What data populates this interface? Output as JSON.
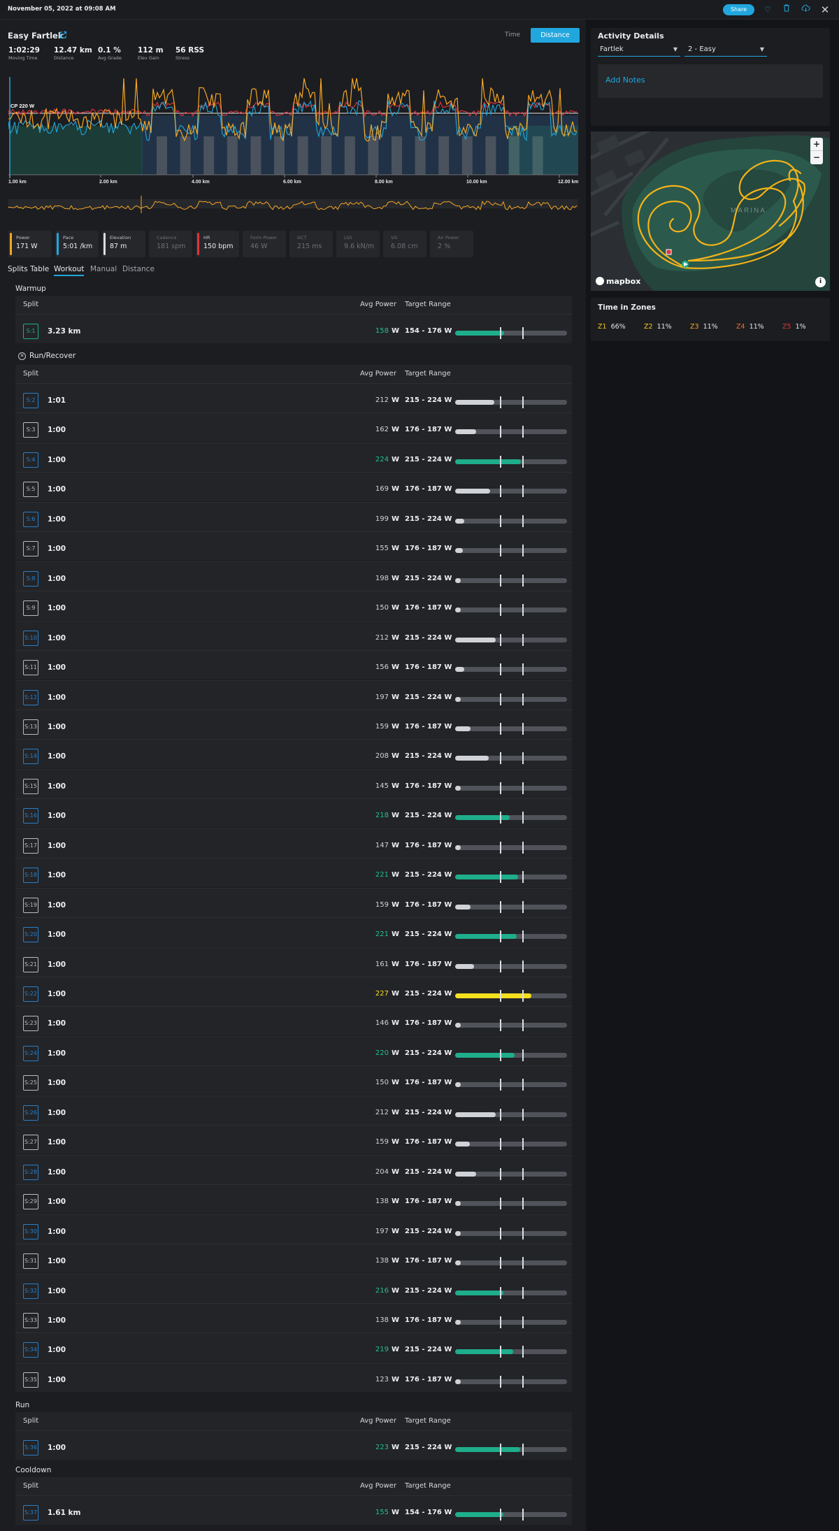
{
  "header": {
    "date": "November 05, 2022 at 09:08 AM",
    "share_label": "Share"
  },
  "activity": {
    "title": "Easy Fartlek",
    "toggle_time": "Time",
    "toggle_distance": "Distance"
  },
  "stats": [
    {
      "value": "1:02:29",
      "label": "Moving Time"
    },
    {
      "value": "12.47 km",
      "label": "Distance"
    },
    {
      "value": "0.1 %",
      "label": "Avg Grade"
    },
    {
      "value": "112 m",
      "label": "Elev Gain"
    },
    {
      "value": "56 RSS",
      "label": "Stress"
    }
  ],
  "chart": {
    "cp_label": "CP 220 W",
    "x_ticks": [
      "1.00 km",
      "2.00 km",
      "4.00 km",
      "6.00 km",
      "8.00 km",
      "10.00 km",
      "12.00 km"
    ]
  },
  "metrics": [
    {
      "name": "Power",
      "value": "171 W",
      "color": "#f5a623",
      "active": true
    },
    {
      "name": "Pace",
      "value": "5:01 /km",
      "color": "#21a7dd",
      "active": true
    },
    {
      "name": "Elevation",
      "value": "87 m",
      "color": "#d9dce1",
      "active": true
    },
    {
      "name": "Cadence",
      "value": "181 spm",
      "color": "",
      "active": false
    },
    {
      "name": "HR",
      "value": "150 bpm",
      "color": "#e0343e",
      "active": true
    },
    {
      "name": "Form Power",
      "value": "46 W",
      "color": "",
      "active": false
    },
    {
      "name": "GCT",
      "value": "215 ms",
      "color": "",
      "active": false
    },
    {
      "name": "LSS",
      "value": "9.6 kN/m",
      "color": "",
      "active": false
    },
    {
      "name": "VO",
      "value": "6.08 cm",
      "color": "",
      "active": false
    },
    {
      "name": "Air Power",
      "value": "2 %",
      "color": "",
      "active": false
    }
  ],
  "tabs": [
    "Splits Table",
    "Workout",
    "Manual",
    "Distance"
  ],
  "columns": {
    "split": "Split",
    "avg_power": "Avg Power",
    "target_range": "Target Range",
    "unit": "W"
  },
  "sections": {
    "warmup": "Warmup",
    "run_recover": "Run/Recover",
    "run": "Run",
    "cooldown": "Cooldown"
  },
  "warmup_rows": [
    {
      "id": "S:1",
      "split": "3.23 km",
      "power": "158",
      "range": "154 - 176 W",
      "fill": 0.44,
      "color": "green",
      "badge": "green"
    }
  ],
  "run_recover_rows": [
    {
      "id": "S:2",
      "split": "1:01",
      "power": "212",
      "range": "215 - 224 W",
      "fill": 0.35,
      "color": "gray",
      "badge": "blue"
    },
    {
      "id": "S:3",
      "split": "1:00",
      "power": "162",
      "range": "176 - 187 W",
      "fill": 0.19,
      "color": "gray",
      "badge": "gray"
    },
    {
      "id": "S:4",
      "split": "1:00",
      "power": "224",
      "range": "215 - 224 W",
      "fill": 0.59,
      "color": "green",
      "badge": "blue"
    },
    {
      "id": "S:5",
      "split": "1:00",
      "power": "169",
      "range": "176 - 187 W",
      "fill": 0.31,
      "color": "gray",
      "badge": "gray"
    },
    {
      "id": "S:6",
      "split": "1:00",
      "power": "199",
      "range": "215 - 224 W",
      "fill": 0.08,
      "color": "gray",
      "badge": "blue"
    },
    {
      "id": "S:7",
      "split": "1:00",
      "power": "155",
      "range": "176 - 187 W",
      "fill": 0.07,
      "color": "gray",
      "badge": "gray"
    },
    {
      "id": "S:8",
      "split": "1:00",
      "power": "198",
      "range": "215 - 224 W",
      "fill": 0.04,
      "color": "gray",
      "badge": "blue"
    },
    {
      "id": "S:9",
      "split": "1:00",
      "power": "150",
      "range": "176 - 187 W",
      "fill": 0.04,
      "color": "gray",
      "badge": "gray"
    },
    {
      "id": "S:10",
      "split": "1:00",
      "power": "212",
      "range": "215 - 224 W",
      "fill": 0.36,
      "color": "gray",
      "badge": "blue"
    },
    {
      "id": "S:11",
      "split": "1:00",
      "power": "156",
      "range": "176 - 187 W",
      "fill": 0.08,
      "color": "gray",
      "badge": "gray"
    },
    {
      "id": "S:12",
      "split": "1:00",
      "power": "197",
      "range": "215 - 224 W",
      "fill": 0.04,
      "color": "gray",
      "badge": "blue"
    },
    {
      "id": "S:13",
      "split": "1:00",
      "power": "159",
      "range": "176 - 187 W",
      "fill": 0.14,
      "color": "gray",
      "badge": "gray"
    },
    {
      "id": "S:14",
      "split": "1:00",
      "power": "208",
      "range": "215 - 224 W",
      "fill": 0.3,
      "color": "gray",
      "badge": "blue"
    },
    {
      "id": "S:15",
      "split": "1:00",
      "power": "145",
      "range": "176 - 187 W",
      "fill": 0.04,
      "color": "gray",
      "badge": "gray"
    },
    {
      "id": "S:16",
      "split": "1:00",
      "power": "218",
      "range": "215 - 224 W",
      "fill": 0.49,
      "color": "green",
      "badge": "blue"
    },
    {
      "id": "S:17",
      "split": "1:00",
      "power": "147",
      "range": "176 - 187 W",
      "fill": 0.04,
      "color": "gray",
      "badge": "gray"
    },
    {
      "id": "S:18",
      "split": "1:00",
      "power": "221",
      "range": "215 - 224 W",
      "fill": 0.56,
      "color": "green",
      "badge": "blue"
    },
    {
      "id": "S:19",
      "split": "1:00",
      "power": "159",
      "range": "176 - 187 W",
      "fill": 0.14,
      "color": "gray",
      "badge": "gray"
    },
    {
      "id": "S:20",
      "split": "1:00",
      "power": "221",
      "range": "215 - 224 W",
      "fill": 0.55,
      "color": "green",
      "badge": "blue"
    },
    {
      "id": "S:21",
      "split": "1:00",
      "power": "161",
      "range": "176 - 187 W",
      "fill": 0.17,
      "color": "gray",
      "badge": "gray"
    },
    {
      "id": "S:22",
      "split": "1:00",
      "power": "227",
      "range": "215 - 224 W",
      "fill": 0.68,
      "color": "yellow",
      "badge": "blue"
    },
    {
      "id": "S:23",
      "split": "1:00",
      "power": "146",
      "range": "176 - 187 W",
      "fill": 0.04,
      "color": "gray",
      "badge": "gray"
    },
    {
      "id": "S:24",
      "split": "1:00",
      "power": "220",
      "range": "215 - 224 W",
      "fill": 0.53,
      "color": "green",
      "badge": "blue"
    },
    {
      "id": "S:25",
      "split": "1:00",
      "power": "150",
      "range": "176 - 187 W",
      "fill": 0.04,
      "color": "gray",
      "badge": "gray"
    },
    {
      "id": "S:26",
      "split": "1:00",
      "power": "212",
      "range": "215 - 224 W",
      "fill": 0.36,
      "color": "gray",
      "badge": "blue"
    },
    {
      "id": "S:27",
      "split": "1:00",
      "power": "159",
      "range": "176 - 187 W",
      "fill": 0.13,
      "color": "gray",
      "badge": "gray"
    },
    {
      "id": "S:28",
      "split": "1:00",
      "power": "204",
      "range": "215 - 224 W",
      "fill": 0.19,
      "color": "gray",
      "badge": "blue"
    },
    {
      "id": "S:29",
      "split": "1:00",
      "power": "138",
      "range": "176 - 187 W",
      "fill": 0.04,
      "color": "gray",
      "badge": "gray"
    },
    {
      "id": "S:30",
      "split": "1:00",
      "power": "197",
      "range": "215 - 224 W",
      "fill": 0.04,
      "color": "gray",
      "badge": "blue"
    },
    {
      "id": "S:31",
      "split": "1:00",
      "power": "138",
      "range": "176 - 187 W",
      "fill": 0.04,
      "color": "gray",
      "badge": "gray"
    },
    {
      "id": "S:32",
      "split": "1:00",
      "power": "216",
      "range": "215 - 224 W",
      "fill": 0.43,
      "color": "green",
      "badge": "blue"
    },
    {
      "id": "S:33",
      "split": "1:00",
      "power": "138",
      "range": "176 - 187 W",
      "fill": 0.04,
      "color": "gray",
      "badge": "gray"
    },
    {
      "id": "S:34",
      "split": "1:00",
      "power": "219",
      "range": "215 - 224 W",
      "fill": 0.52,
      "color": "green",
      "badge": "blue"
    },
    {
      "id": "S:35",
      "split": "1:00",
      "power": "123",
      "range": "176 - 187 W",
      "fill": 0.04,
      "color": "gray",
      "badge": "gray"
    }
  ],
  "run_rows": [
    {
      "id": "S:36",
      "split": "1:00",
      "power": "223",
      "range": "215 - 224 W",
      "fill": 0.58,
      "color": "green",
      "badge": "blue"
    }
  ],
  "cooldown_rows": [
    {
      "id": "S:37",
      "split": "1.61 km",
      "power": "155",
      "range": "154 - 176 W",
      "fill": 0.43,
      "color": "green",
      "badge": "blue"
    }
  ],
  "activity_details": {
    "title": "Activity Details",
    "workout_type": "Fartlek",
    "intensity": "2 - Easy",
    "add_notes": "Add Notes"
  },
  "map": {
    "place_label": "MARINA",
    "zoom_in": "+",
    "zoom_out": "−",
    "brand": "mapbox",
    "info": "i"
  },
  "zones": {
    "title": "Time in Zones",
    "items": [
      {
        "zone": "Z1",
        "pct": "66%",
        "color": "#f5c518"
      },
      {
        "zone": "Z2",
        "pct": "11%",
        "color": "#f5c518"
      },
      {
        "zone": "Z3",
        "pct": "11%",
        "color": "#f5a623"
      },
      {
        "zone": "Z4",
        "pct": "11%",
        "color": "#ef6c2c"
      },
      {
        "zone": "Z5",
        "pct": "1%",
        "color": "#d93535"
      }
    ]
  },
  "colors": {
    "accent": "#21a7dd",
    "green": "#1fae8c",
    "yellow": "#f5e01e",
    "gray": "#cfd2d7"
  }
}
